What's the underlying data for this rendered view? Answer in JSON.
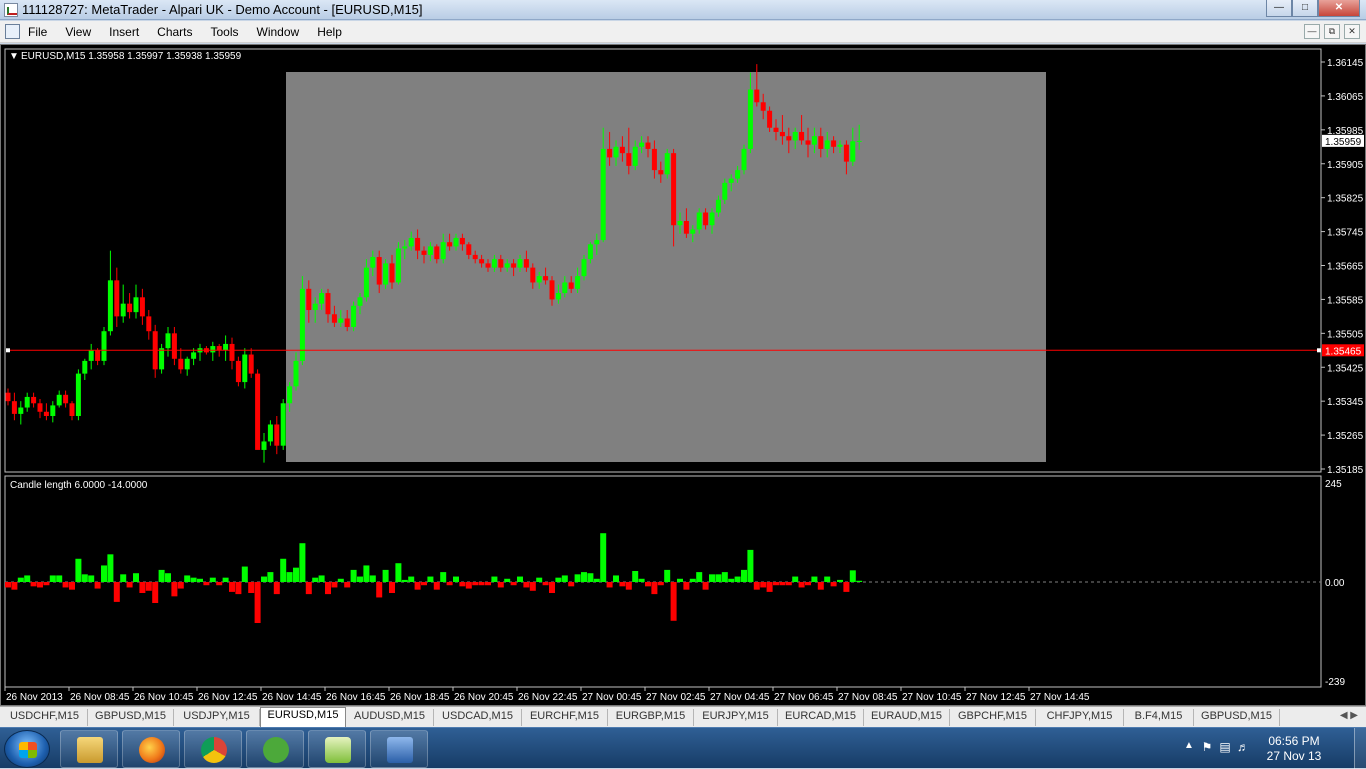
{
  "window": {
    "title": "111128727: MetaTrader - Alpari UK - Demo Account - [EURUSD,M15]"
  },
  "menu": [
    "File",
    "View",
    "Insert",
    "Charts",
    "Tools",
    "Window",
    "Help"
  ],
  "chart": {
    "header": "EURUSD,M15  1.35958 1.35997 1.35938 1.35959",
    "price_labels": [
      "1.36145",
      "1.36065",
      "1.35985",
      "1.35905",
      "1.35825",
      "1.35745",
      "1.35665",
      "1.35585",
      "1.35505",
      "1.35425",
      "1.35345",
      "1.35265",
      "1.35185"
    ],
    "current_price": "1.35959",
    "hline_price": "1.35465",
    "time_labels": [
      "26 Nov 2013",
      "26 Nov 08:45",
      "26 Nov 10:45",
      "26 Nov 12:45",
      "26 Nov 14:45",
      "26 Nov 16:45",
      "26 Nov 18:45",
      "26 Nov 20:45",
      "26 Nov 22:45",
      "27 Nov 00:45",
      "27 Nov 02:45",
      "27 Nov 04:45",
      "27 Nov 06:45",
      "27 Nov 08:45",
      "27 Nov 10:45",
      "27 Nov 12:45",
      "27 Nov 14:45"
    ],
    "indicator_label": "Candle length 6.0000 -14.0000",
    "indicator_scale": [
      "245",
      "0.00",
      "-239"
    ],
    "colors": {
      "background": "#000000",
      "bull": "#00ff00",
      "bear": "#ff0000",
      "highlight": "#808080",
      "hline": "#ff0000"
    }
  },
  "tabs": [
    "USDCHF,M15",
    "GBPUSD,M15",
    "USDJPY,M15",
    "EURUSD,M15",
    "AUDUSD,M15",
    "USDCAD,M15",
    "EURCHF,M15",
    "EURGBP,M15",
    "EURJPY,M15",
    "EURCAD,M15",
    "EURAUD,M15",
    "GBPCHF,M15",
    "CHFJPY,M15",
    "B.F4,M15",
    "GBPUSD,M15"
  ],
  "active_tab": "EURUSD,M15",
  "taskbar": {
    "apps": [
      "explorer-icon",
      "firefox-icon",
      "chrome-icon",
      "utorrent-icon",
      "metatrader-icon",
      "word-icon"
    ],
    "time": "06:56 PM",
    "date": "27 Nov 13"
  }
}
